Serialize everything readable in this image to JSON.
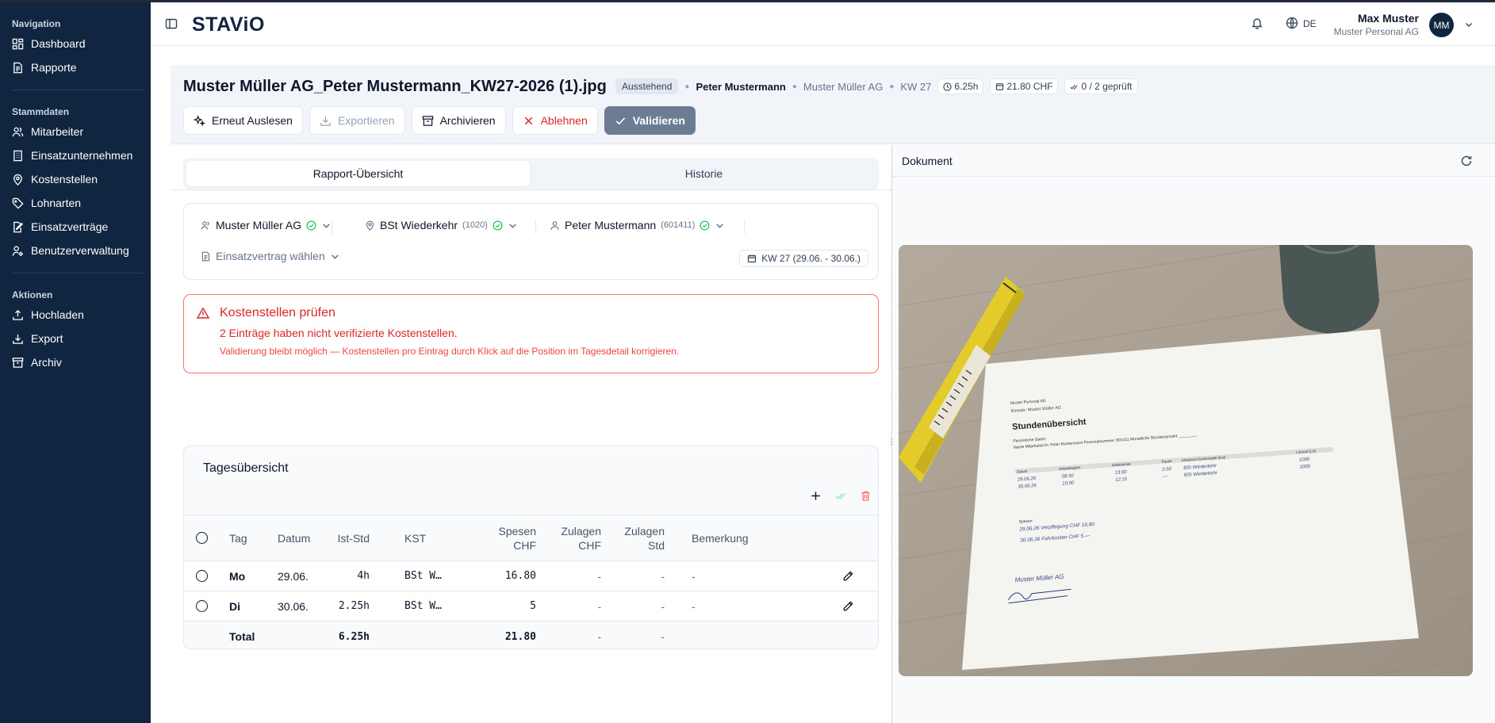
{
  "sidebar": {
    "sections": [
      {
        "title": "Navigation",
        "items": [
          "Dashboard",
          "Rapporte"
        ]
      },
      {
        "title": "Stammdaten",
        "items": [
          "Mitarbeiter",
          "Einsatzunternehmen",
          "Kostenstellen",
          "Lohnarten",
          "Einsatzverträge",
          "Benutzerverwaltung"
        ]
      },
      {
        "title": "Aktionen",
        "items": [
          "Hochladen",
          "Export",
          "Archiv"
        ]
      }
    ]
  },
  "header": {
    "logo": "STAViO",
    "language": "DE",
    "user_name": "Max Muster",
    "user_org": "Muster Personal AG",
    "user_initials": "MM"
  },
  "document": {
    "title": "Muster Müller AG_Peter Mustermann_KW27-2026 (1).jpg",
    "status": "Ausstehend",
    "employee": "Peter Mustermann",
    "company": "Muster Müller AG",
    "week": "KW 27",
    "hours": "6.25h",
    "amount": "21.80 CHF",
    "checked": "0 / 2 geprüft"
  },
  "actions": {
    "reread": "Erneut Auslesen",
    "export": "Exportieren",
    "archive": "Archivieren",
    "reject": "Ablehnen",
    "validate": "Validieren"
  },
  "tabs": {
    "overview": "Rapport-Übersicht",
    "history": "Historie"
  },
  "selectors": {
    "company": "Muster Müller AG",
    "cost_center": "BSt Wiederkehr",
    "cost_center_code": "(1020)",
    "employee": "Peter Mustermann",
    "employee_code": "(601411)",
    "contract_placeholder": "Einsatzvertrag wählen",
    "week_range": "KW 27 (29.06. - 30.06.)"
  },
  "alert": {
    "title": "Kostenstellen prüfen",
    "message": "2 Einträge haben nicht verifizierte Kostenstellen.",
    "hint": "Validierung bleibt möglich — Kostenstellen pro Eintrag durch Klick auf die Position im Tagesdetail korrigieren."
  },
  "days": {
    "title": "Tagesübersicht",
    "columns": {
      "tag": "Tag",
      "datum": "Datum",
      "ist": "Ist-Std",
      "kst": "KST",
      "spesen_1": "Spesen",
      "spesen_2": "CHF",
      "zul_chf_1": "Zulagen",
      "zul_chf_2": "CHF",
      "zul_std_1": "Zulagen",
      "zul_std_2": "Std",
      "bemerkung": "Bemerkung"
    },
    "rows": [
      {
        "tag": "Mo",
        "datum": "29.06.",
        "ist": "4h",
        "kst": "BSt W…",
        "spesen": "16.80",
        "zul_chf": "-",
        "zul_std": "-",
        "bemerkung": "-"
      },
      {
        "tag": "Di",
        "datum": "30.06.",
        "ist": "2.25h",
        "kst": "BSt W…",
        "spesen": "5",
        "zul_chf": "-",
        "zul_std": "-",
        "bemerkung": "-"
      }
    ],
    "total": {
      "label": "Total",
      "ist": "6.25h",
      "spesen": "21.80",
      "zul_chf": "-",
      "zul_std": "-"
    }
  },
  "document_panel": {
    "title": "Dokument"
  },
  "scan": {
    "company_line": "Muster Personal AG",
    "einsatz_line": "Einsatz: Muster Müller AG",
    "heading": "Stundenübersicht",
    "personal": "Persönliche Daten:",
    "name_line": "Name Mitarbeiter/in: Peter Mustermann  Personalnummer: 601411    Monatliche Stundenanzahl: ________",
    "cols": [
      "Datum",
      "Arbeitsbeginn",
      "Arbeitsende",
      "Pause",
      "Arbeitsort Kostenstelle (Kst)",
      "Lohnart (LA)"
    ],
    "row1": [
      "29.06.26",
      "08:30",
      "13:00",
      "0.50",
      "BSt Wiederkehr",
      "1000"
    ],
    "row2": [
      "30.06.26",
      "10:00",
      "12:15",
      "—",
      "BSt Wiederkehr",
      "1000"
    ],
    "spesen_label": "Spesen:",
    "spesen1": "29.06.26   Verpflegung   CHF  16.80",
    "spesen2": "30.06.26   Fahrkosten   CHF  5.—",
    "signature": "Muster Müller AG"
  }
}
